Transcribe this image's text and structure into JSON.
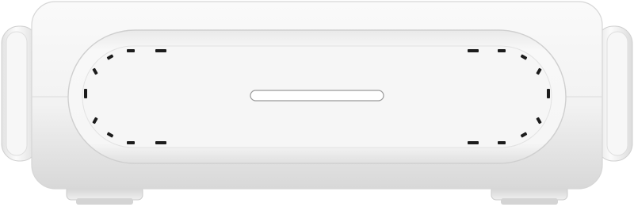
{
  "product_photo": {
    "subject": "white-router-device-side-view",
    "colors": {
      "background": "#ffffff",
      "body": "#f4f4f4",
      "body_shadow": "#d9d9d9",
      "panel": "#f7f7f7",
      "vent_marks": "#1c1c1c",
      "indicator": "#ffffff"
    }
  }
}
